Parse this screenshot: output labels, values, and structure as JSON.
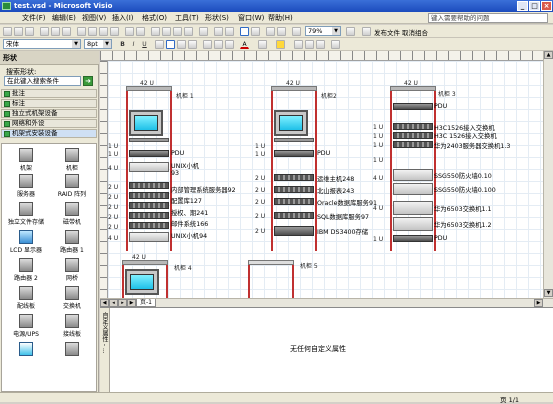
{
  "window": {
    "title": "test.vsd - Microsoft Visio"
  },
  "menu": {
    "items": [
      "文件(F)",
      "编辑(E)",
      "视图(V)",
      "插入(I)",
      "格式(O)",
      "工具(T)",
      "形状(S)",
      "窗口(W)",
      "帮助(H)"
    ],
    "help_placeholder": "键入需要帮助的问题"
  },
  "toolbar": {
    "zoom": "79%",
    "publish_label": "发布文件",
    "cancel_group_label": "取消组合",
    "font": "宋体",
    "font_size": "8pt"
  },
  "shapes_panel": {
    "title": "形状",
    "search_label": "搜索形状:",
    "search_placeholder": "在此键入搜索条件",
    "stencils": [
      "批注",
      "标注",
      "独立式机架设备",
      "网络和外设",
      "机架式安装设备"
    ],
    "shapes": [
      "机架",
      "机柜",
      "服务器",
      "RAID 阵列",
      "独立文件存储",
      "磁带机",
      "LCD 显示器",
      "路由器 1",
      "路由器 2",
      "网桥",
      "配线板",
      "交换机",
      "电源/UPS",
      "接线板"
    ]
  },
  "canvas": {
    "racks": [
      {
        "name": "机柜 1",
        "height": "42 U"
      },
      {
        "name": "机柜2",
        "height": "42 U"
      },
      {
        "name": "机柜 3",
        "height": "42 U"
      },
      {
        "name": "机柜 4",
        "height": "42 U"
      },
      {
        "name": "机柜 5",
        "height": ""
      }
    ],
    "rack1_devices": [
      "PDU",
      "UNIX小机93",
      "内部管理系统服务器92",
      "配置库127",
      "授权、期241",
      "邮件系统166",
      "UNIX小机94"
    ],
    "rack1_units": [
      "1 U",
      "1 U",
      "4 U",
      "2 U",
      "2 U",
      "2 U",
      "2 U",
      "2 U",
      "4 U"
    ],
    "rack2_devices": [
      "PDU",
      "运维主机248",
      "北山报表243",
      "Oracle数据库服务91",
      "SQL数据库服务97",
      "IBM DS3400存储"
    ],
    "rack2_units": [
      "1 U",
      "1 U",
      "2 U",
      "2 U",
      "2 U",
      "2 U",
      "2 U"
    ],
    "rack3_devices": [
      "PDU",
      "H3C1526接入交换机",
      "H3C 1526接入交换机",
      "华为2403服务器交换机1.3",
      "SSG550防火墙0.10",
      "SSG550防火墙0.100",
      "华为6503交换机1.1",
      "华为6503交换机1.2",
      "PDU"
    ],
    "rack3_units": [
      "1 U",
      "1 U",
      "1 U",
      "1 U",
      "4 U",
      "4 U",
      "1 U"
    ]
  },
  "page_tab": "页-1",
  "props_panel": {
    "side_label": "自定义属性 - ...",
    "empty_text": "无任何自定义属性"
  },
  "status": {
    "page": "页 1/1"
  }
}
